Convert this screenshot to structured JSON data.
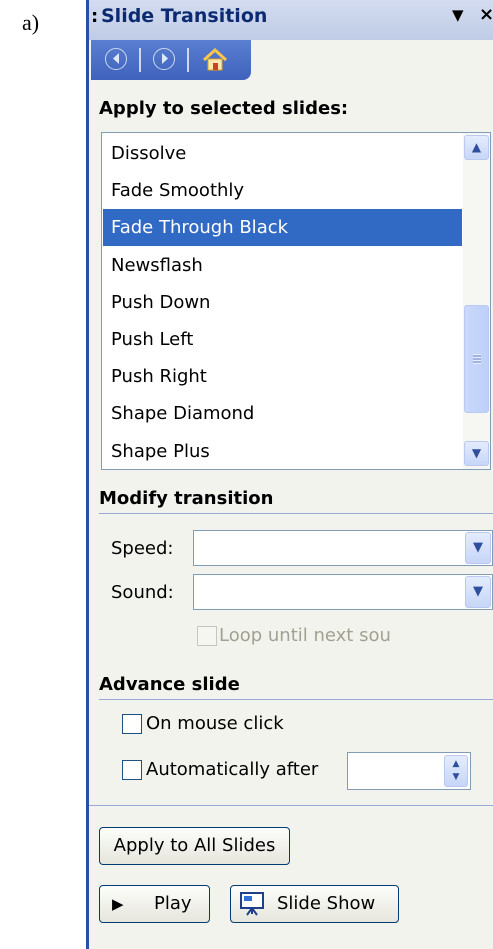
{
  "caption": "a)",
  "pane": {
    "title": "Slide Transition",
    "grip": ":",
    "dropdown_icon": "▼",
    "close_icon": "×"
  },
  "nav": {
    "back_icon": "back-arrow-icon",
    "forward_icon": "forward-arrow-icon",
    "home_icon": "home-icon"
  },
  "apply_section": {
    "heading": "Apply to selected slides:",
    "items": [
      "Dissolve",
      "Fade Smoothly",
      "Fade Through Black",
      "Newsflash",
      "Push Down",
      "Push Left",
      "Push Right",
      "Shape Diamond",
      "Shape Plus"
    ],
    "selected": "Fade Through Black"
  },
  "modify_section": {
    "heading": "Modify transition",
    "speed_label": "Speed:",
    "speed_value": "",
    "sound_label": "Sound:",
    "sound_value": "",
    "loop_label": "Loop until next sou"
  },
  "advance_section": {
    "heading": "Advance slide",
    "on_click_label": "On mouse click",
    "auto_label": "Automatically after",
    "auto_value": ""
  },
  "buttons": {
    "apply_all": "Apply to All Slides",
    "play": "Play",
    "slide_show": "Slide Show"
  },
  "colors": {
    "selection": "#316ac5",
    "titlebar": "#c0cce6",
    "nav": "#3f63bd",
    "pane_bg": "#f3f3ee"
  }
}
